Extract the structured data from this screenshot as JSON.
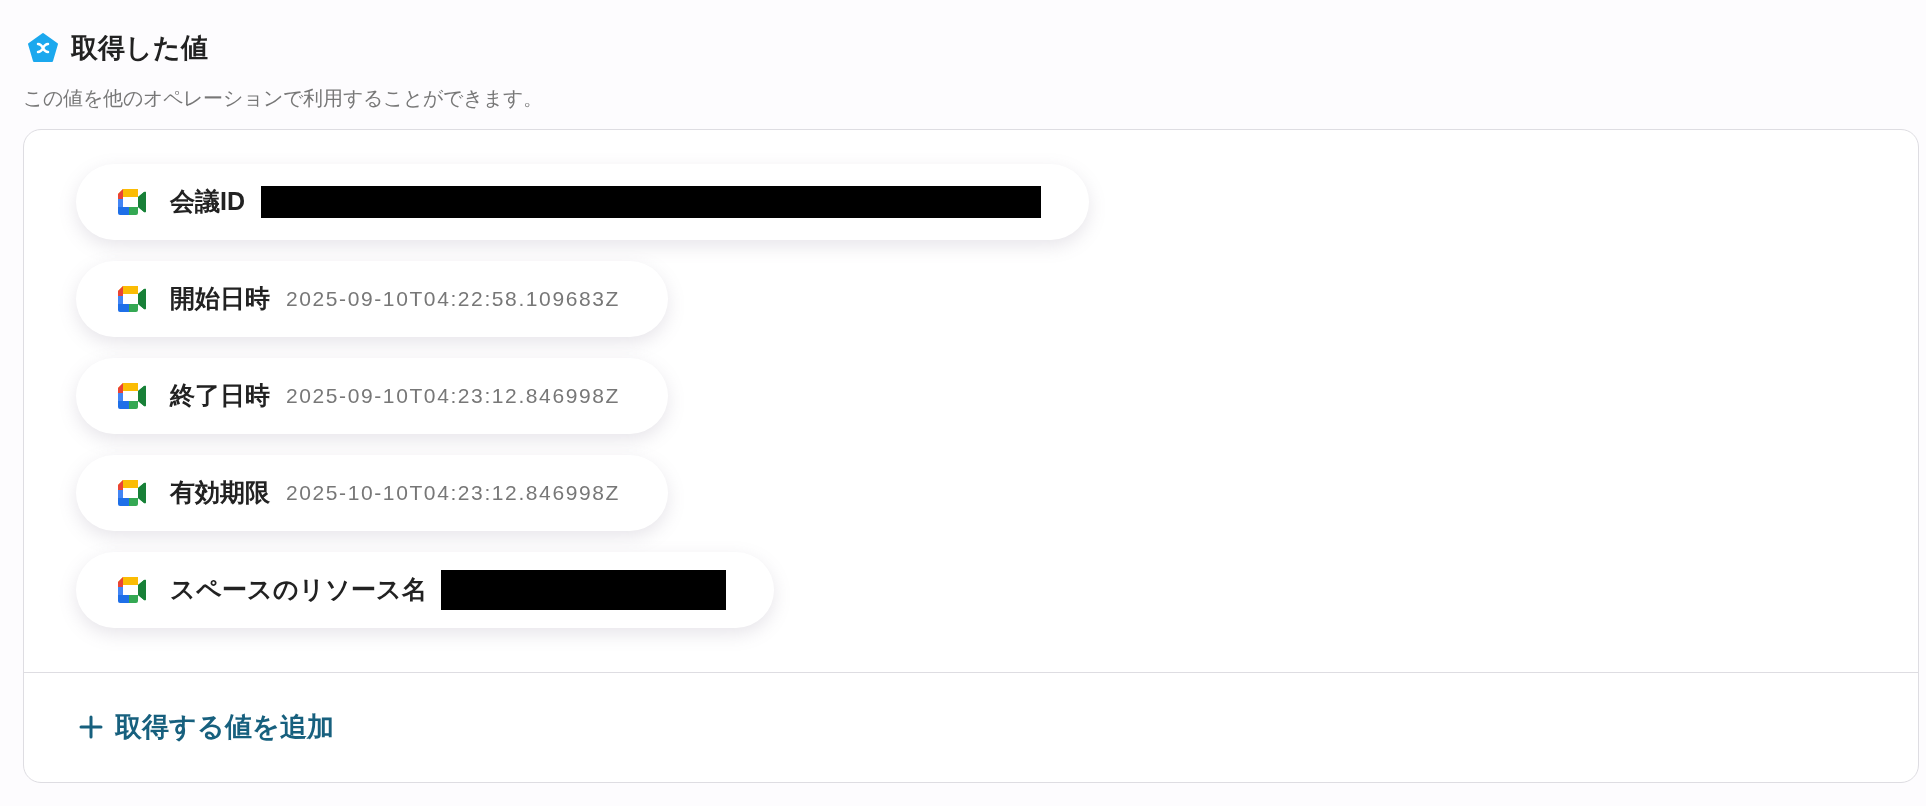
{
  "header": {
    "title": "取得した値",
    "description": "この値を他のオペレーションで利用することができます。"
  },
  "values": [
    {
      "label": "会議ID",
      "redacted": true
    },
    {
      "label": "開始日時",
      "redacted": false,
      "value": "2025-09-10T04:22:58.109683Z"
    },
    {
      "label": "終了日時",
      "redacted": false,
      "value": "2025-09-10T04:23:12.846998Z"
    },
    {
      "label": "有効期限",
      "redacted": false,
      "value": "2025-10-10T04:23:12.846998Z"
    },
    {
      "label": "スペースのリソース名",
      "redacted": true
    }
  ],
  "add_button": {
    "label": "取得する値を追加"
  }
}
